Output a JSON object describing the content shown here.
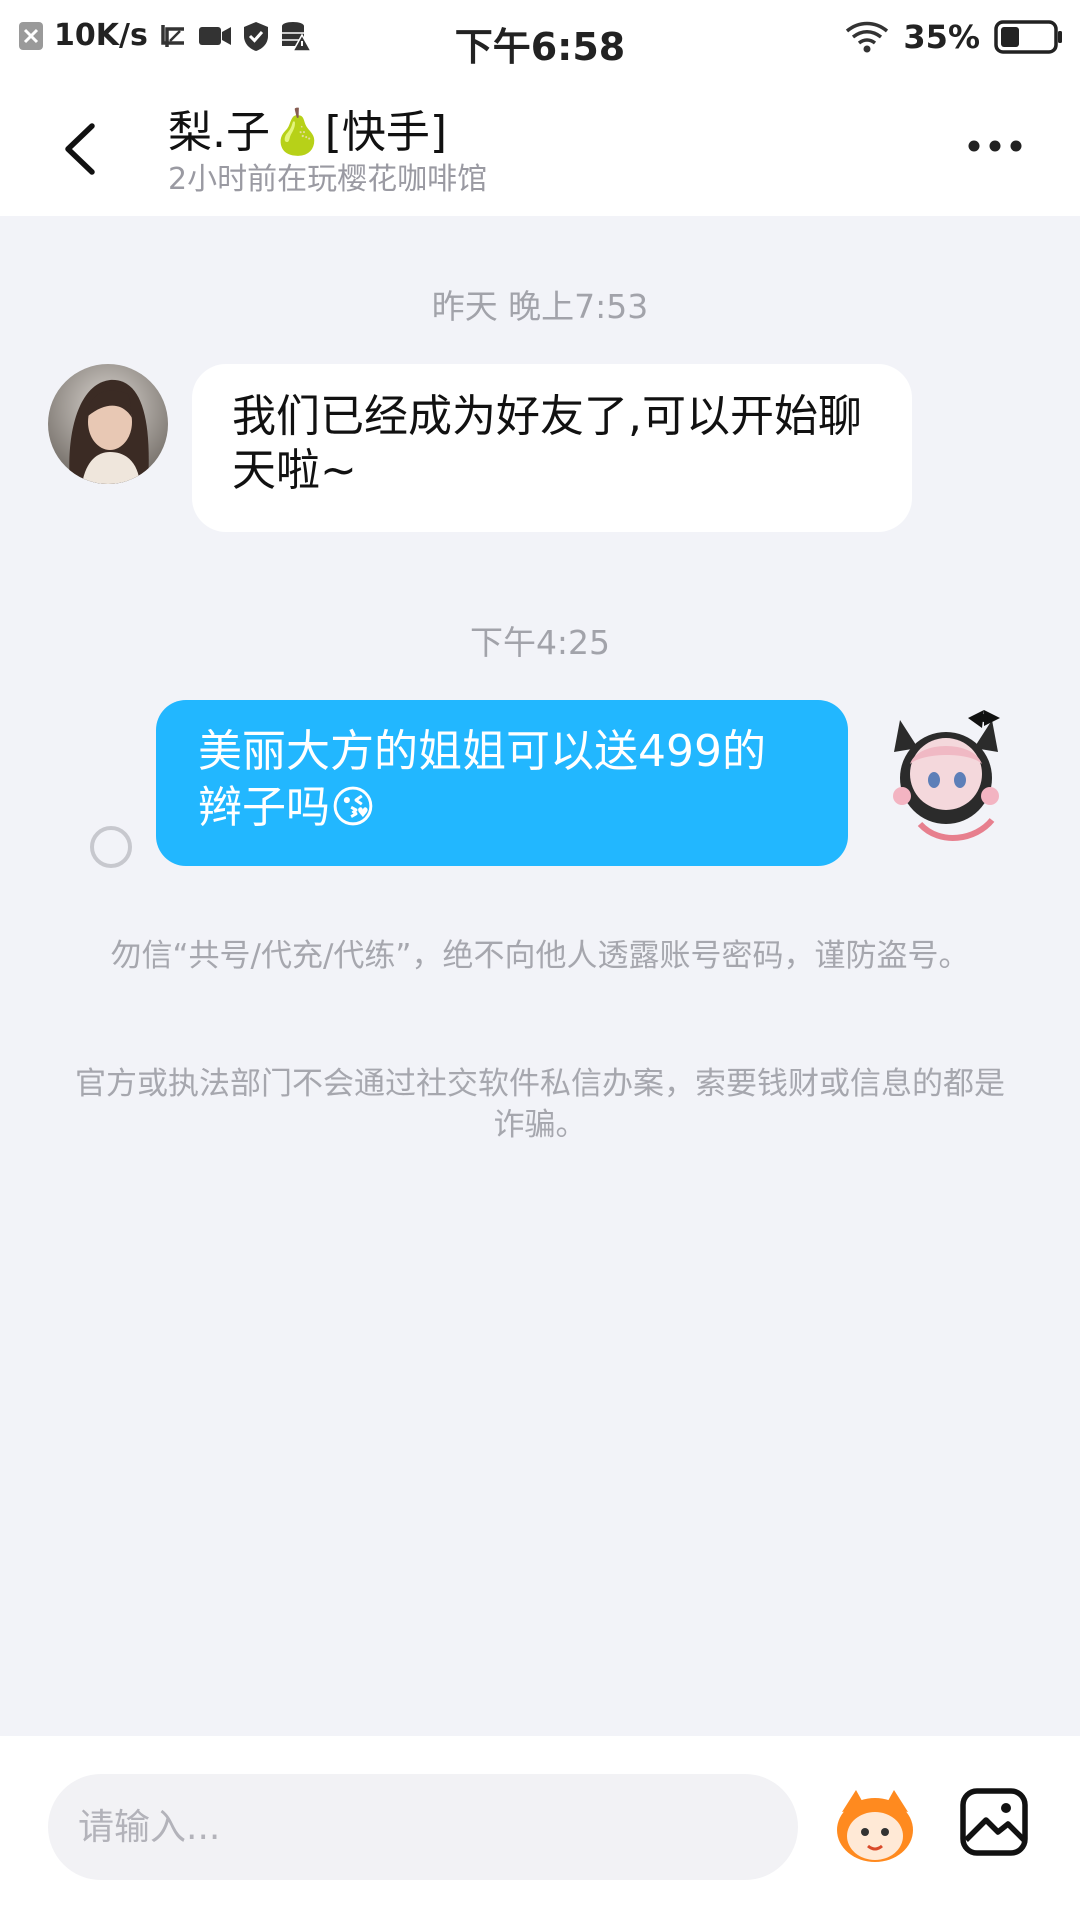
{
  "status_bar": {
    "speed": "10K/s",
    "time": "下午6:58",
    "battery": "35%",
    "battery_level": 0.35
  },
  "header": {
    "contact_name": "梨.子🍐[快手]",
    "activity_status": "2小时前在玩樱花咖啡馆"
  },
  "chat": {
    "timestamp_1": "昨天 晚上7:53",
    "incoming_message_1": "我们已经成为好友了,可以开始聊天啦~",
    "timestamp_2": "下午4:25",
    "outgoing_message_1": "美丽大方的姐姐可以送499的辫子吗😘",
    "notice_1": "勿信“共号/代充/代练”，绝不向他人透露账号密码，谨防盗号。",
    "notice_2": "官方或执法部门不会通过社交软件私信办案，索要钱财或信息的都是诈骗。"
  },
  "input": {
    "placeholder": "请输入..."
  },
  "colors": {
    "outgoing_bubble": "#22b7ff",
    "chat_background": "#f2f3f8"
  },
  "icons": [
    "close-box-icon",
    "screenshot-icon",
    "video-icon",
    "shield-icon",
    "database-warning-icon",
    "wifi-icon",
    "battery-icon",
    "back-arrow-icon",
    "more-dots-icon",
    "sticker-mascot-icon",
    "image-icon"
  ]
}
